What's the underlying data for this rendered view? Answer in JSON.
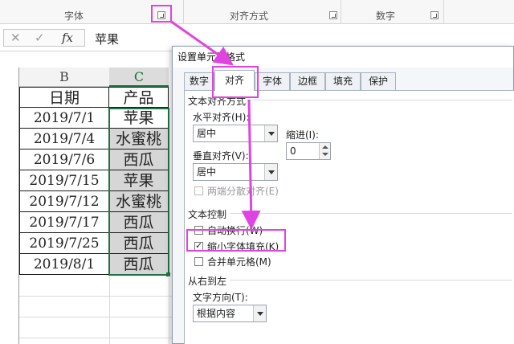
{
  "ribbon": {
    "groups": [
      "字体",
      "对齐方式",
      "数字"
    ]
  },
  "formula_bar": {
    "cancel_icon": "✕",
    "confirm_icon": "✓",
    "fx_label": "fx",
    "content": "苹果"
  },
  "sheet": {
    "columns": [
      "B",
      "C"
    ],
    "header_row": [
      "日期",
      "产品"
    ],
    "rows": [
      {
        "date": "2019/7/1",
        "product": "苹果"
      },
      {
        "date": "2019/7/4",
        "product": "水蜜桃"
      },
      {
        "date": "2019/7/6",
        "product": "西瓜"
      },
      {
        "date": "2019/7/15",
        "product": "苹果"
      },
      {
        "date": "2019/7/12",
        "product": "水蜜桃"
      },
      {
        "date": "2019/7/17",
        "product": "西瓜"
      },
      {
        "date": "2019/7/25",
        "product": "西瓜"
      },
      {
        "date": "2019/8/1",
        "product": "西瓜"
      }
    ]
  },
  "dialog": {
    "title": "设置单元格格式",
    "tabs": [
      "数字",
      "对齐",
      "字体",
      "边框",
      "填充",
      "保护"
    ],
    "active_tab": "对齐",
    "text_alignment": {
      "section": "文本对齐方式",
      "horizontal_label": "水平对齐(H):",
      "horizontal_value": "居中",
      "indent_label": "缩进(I):",
      "indent_value": "0",
      "vertical_label": "垂直对齐(V):",
      "vertical_value": "居中",
      "distributed_label": "两端分散对齐(E)"
    },
    "text_control": {
      "section": "文本控制",
      "wrap_label": "自动换行(W)",
      "shrink_label": "缩小字体填充(K)",
      "shrink_checked": true,
      "merge_label": "合并单元格(M)"
    },
    "rtl": {
      "section": "从右到左",
      "direction_label": "文字方向(T):",
      "direction_value": "根据内容"
    }
  },
  "colors": {
    "highlight": "#e044e0",
    "selection_fill": "#d6d6d6",
    "excel_green": "#217346"
  }
}
